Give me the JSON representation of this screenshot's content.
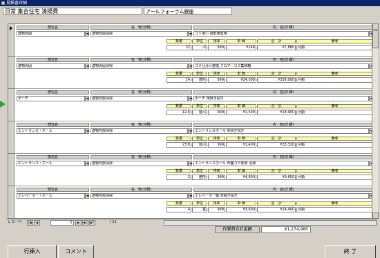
{
  "titlebar": {
    "title": "見積書詳細"
  },
  "header": {
    "title": "日常 集合住宅 清掃費",
    "subtitle": "アールフォーラム銀座"
  },
  "labels": {
    "bumon": "部位名",
    "meisho": "名　称(分類)",
    "naiyo": "内　容(詳 細)",
    "suryo": "数量",
    "tani": "単位",
    "haiku": "排率",
    "tanka": "単 価",
    "goukei": "合　計",
    "biko": "備考"
  },
  "records": [
    {
      "bumon": "建物周囲",
      "meisho": "建物周囲清掃",
      "naiyo": "ゴミ拾い 自転車置場",
      "suryo": "32",
      "tani": "㎡",
      "haiku": "999",
      "tanka": "¥248",
      "goukei": "¥7,880",
      "biko": "月額"
    },
    {
      "bumon": "建物周囲",
      "meisho": "建物周囲清掃",
      "naiyo": "ゴミ仕分け整理 フロアーゴミ集積箱",
      "suryo": "14",
      "tani": "箇所",
      "haiku": "999",
      "tanka": "¥24,000",
      "goukei": "¥336,000",
      "biko": "月額"
    },
    {
      "bumon": "ポーチ",
      "meisho": "建物内部清掃",
      "naiyo": "ポーチ 床掃き拭き",
      "suryo": "12.6",
      "tani": "延㎡",
      "haiku": "999",
      "tanka": "¥1,500",
      "goukei": "¥18,900",
      "biko": "月額"
    },
    {
      "bumon": "エントランス・ホール",
      "meisho": "建物内部清掃",
      "naiyo": "エントランスホール 床掃き拭き",
      "suryo": "23.8",
      "tani": "延㎡",
      "haiku": "999",
      "tanka": "¥1,400",
      "goukei": "¥33,320",
      "biko": "月額"
    },
    {
      "bumon": "エントランス・ホール",
      "meisho": "建物内部清掃",
      "naiyo": "エントランスホール 床面ゴミ除去 清掃",
      "suryo": "2",
      "tani": "箇所",
      "haiku": "999",
      "tanka": "¥4,800",
      "goukei": "¥9,600",
      "biko": "月額"
    },
    {
      "bumon": "エレベーター・ホール",
      "meisho": "建物内部清掃",
      "naiyo": "エレベーター籠 床掃き拭き",
      "suryo": "4",
      "tani": "基",
      "haiku": "999",
      "tanka": "¥3,600",
      "goukei": "¥14,400",
      "biko": "月額"
    }
  ],
  "navbar": {
    "label": "レコード:",
    "current": "3",
    "total": "/ 11"
  },
  "total": {
    "label": "作業費合計金額",
    "value": "¥1,274,980"
  },
  "buttons": {
    "insert": "行挿入",
    "comment": "コメント",
    "close": "終 了"
  },
  "colors": {
    "label_yellow": "#ffff99",
    "title_blue": "#0a246a",
    "arrow_green": "#2ca02c"
  }
}
